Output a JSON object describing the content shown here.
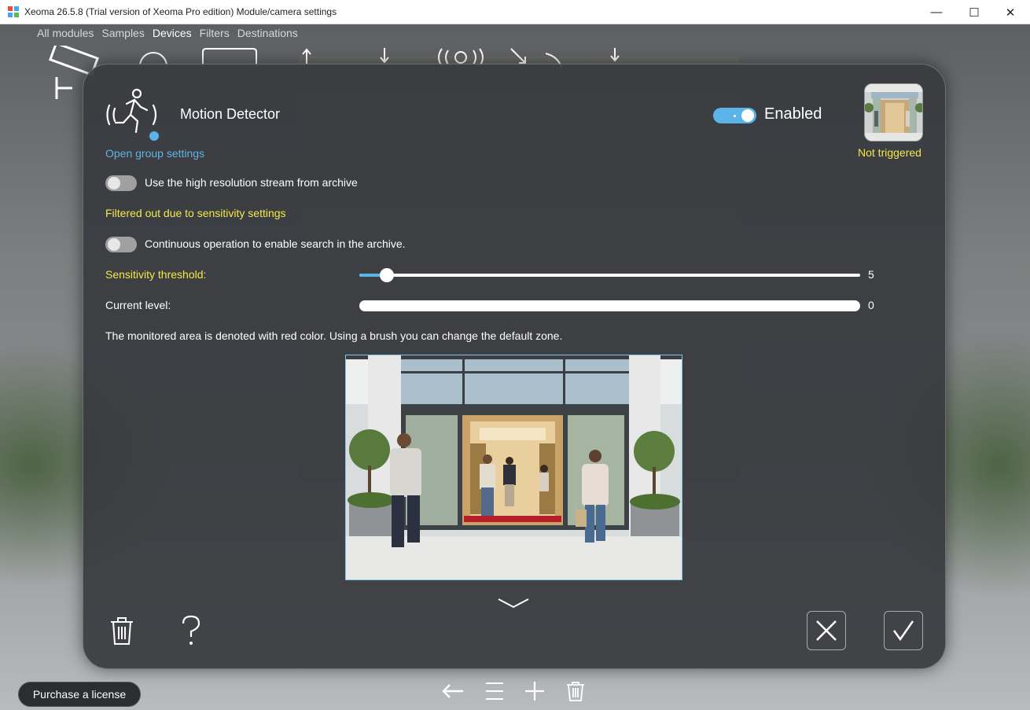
{
  "window": {
    "title": "Xeoma 26.5.8 (Trial version of Xeoma Pro edition) Module/camera settings",
    "minimize": "—",
    "maximize": "☐",
    "close": "✕"
  },
  "topmenu": {
    "items": [
      "All modules",
      "Samples",
      "Devices",
      "Filters",
      "Destinations"
    ],
    "active": "Devices"
  },
  "module": {
    "title": "Motion Detector",
    "icon": "running-person-icon",
    "group_link": "Open group settings",
    "enabled_label": "Enabled",
    "enabled": true,
    "trigger_status": "Not triggered"
  },
  "options": {
    "high_res_label": "Use the high resolution stream from archive",
    "high_res_enabled": false,
    "filtered_out_label": "Filtered out due to sensitivity settings",
    "continuous_label": "Continuous operation to enable search in the archive.",
    "continuous_enabled": false
  },
  "sensitivity": {
    "label": "Sensitivity threshold:",
    "value": "5",
    "fraction": 0.05
  },
  "current_level": {
    "label": "Current level:",
    "value": "0"
  },
  "zone_hint": "The monitored area is denoted with red color. Using a brush you can change the default zone.",
  "buttons": {
    "license": "Purchase a license"
  },
  "colors": {
    "accent": "#5ab4e8",
    "yellow": "#f3e84a",
    "dialog_bg": "#373a3e"
  }
}
